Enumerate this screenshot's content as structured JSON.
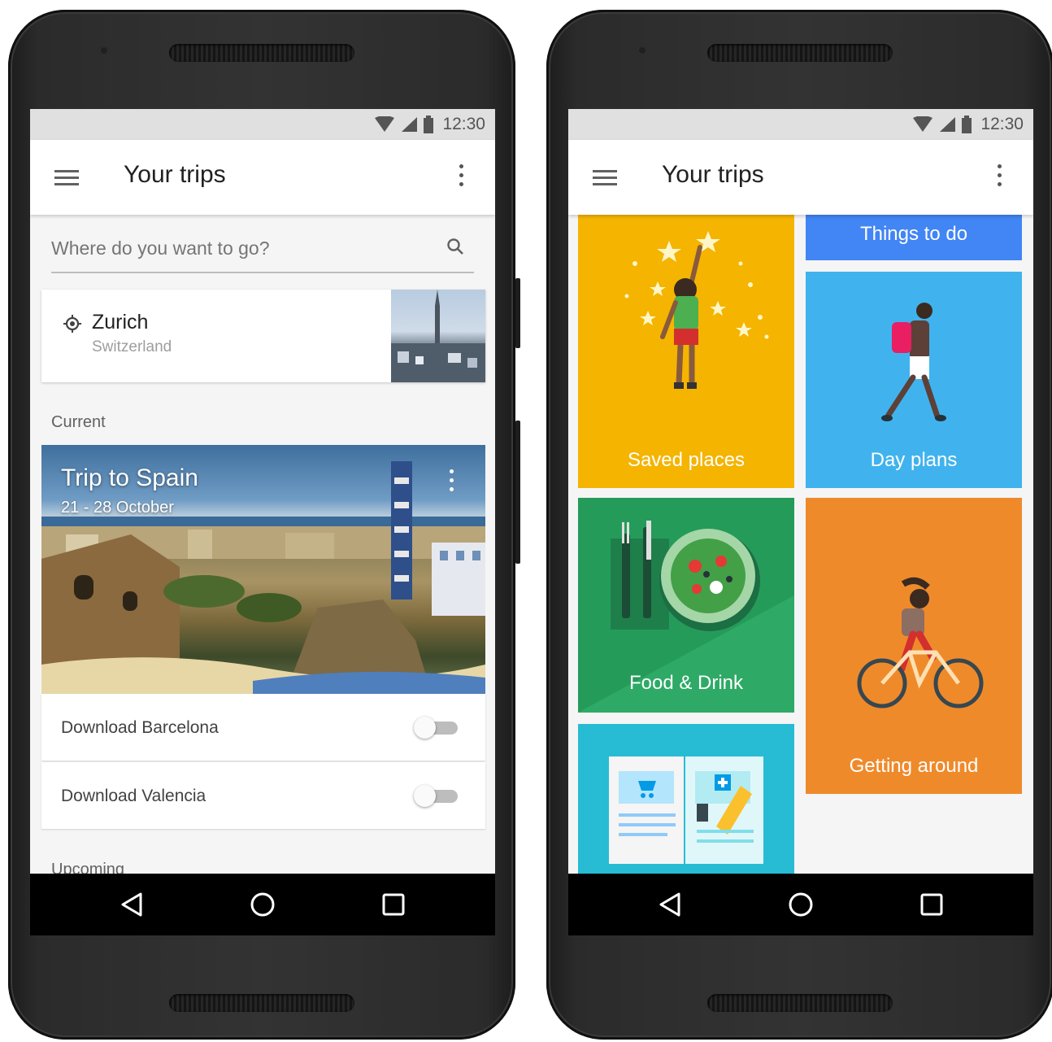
{
  "status": {
    "time": "12:30"
  },
  "left": {
    "title": "Your trips",
    "search": {
      "placeholder": "Where do you want to go?"
    },
    "place": {
      "name": "Zurich",
      "country": "Switzerland"
    },
    "sections": {
      "current": "Current",
      "upcoming": "Upcoming"
    },
    "trip": {
      "title": "Trip to Spain",
      "dates": "21 - 28 October"
    },
    "downloads": [
      {
        "label": "Download Barcelona",
        "on": false
      },
      {
        "label": "Download Valencia",
        "on": false
      }
    ]
  },
  "right": {
    "title": "Your trips",
    "tiles": {
      "things_to_do": {
        "label": "Things to do",
        "color": "#4285f4"
      },
      "saved_places": {
        "label": "Saved places",
        "color": "#f4b400"
      },
      "day_plans": {
        "label": "Day plans",
        "color": "#40b3ee"
      },
      "food_drink": {
        "label": "Food & Drink",
        "color": "#259b5a"
      },
      "getting_around": {
        "label": "Getting around",
        "color": "#ef8a2b"
      },
      "reservations": {
        "label": "",
        "color": "#27bcd4"
      }
    }
  },
  "icons": [
    "menu-icon",
    "more-vert-icon",
    "search-icon",
    "location-icon",
    "wifi-icon",
    "signal-icon",
    "battery-icon",
    "back-icon",
    "home-icon",
    "recents-icon"
  ]
}
